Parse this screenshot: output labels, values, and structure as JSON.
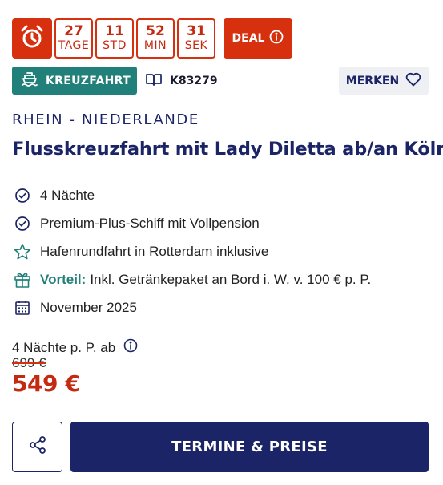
{
  "countdown": {
    "icon": "alarm-clock-icon",
    "units": [
      {
        "value": "27",
        "label": "TAGE"
      },
      {
        "value": "11",
        "label": "STD"
      },
      {
        "value": "52",
        "label": "MIN"
      },
      {
        "value": "31",
        "label": "SEK"
      }
    ],
    "deal_label": "DEAL",
    "deal_icon": "info-icon"
  },
  "trip": {
    "type_label": "KREUZFAHRT",
    "type_icon": "ship-icon",
    "code_icon": "book-icon",
    "code": "K83279",
    "save_label": "MERKEN",
    "save_icon": "heart-icon",
    "region": "RHEIN - NIEDERLANDE",
    "title": "Flusskreuzfahrt mit Lady Diletta ab/an Köln"
  },
  "features": [
    {
      "icon": "check-circle-icon",
      "text": "4 Nächte"
    },
    {
      "icon": "check-circle-icon",
      "text": "Premium-Plus-Schiff mit Vollpension"
    },
    {
      "icon": "star-icon",
      "text": "Hafenrundfahrt in Rotterdam inklusive"
    },
    {
      "icon": "gift-icon",
      "highlight": "Vorteil:",
      "text": "Inkl. Getränkepaket an Bord i. W. v. 100 € p. P."
    },
    {
      "icon": "calendar-icon",
      "text": "November 2025"
    }
  ],
  "price": {
    "label": "4 Nächte p. P. ab",
    "info_icon": "info-icon",
    "old": "699 €",
    "new": "549 €"
  },
  "actions": {
    "share_icon": "share-icon",
    "cta_label": "TERMINE & PREISE"
  },
  "colors": {
    "deal_red": "#d6300f",
    "teal": "#22807a",
    "navy": "#1b2466",
    "light_gray": "#eef0f3"
  }
}
